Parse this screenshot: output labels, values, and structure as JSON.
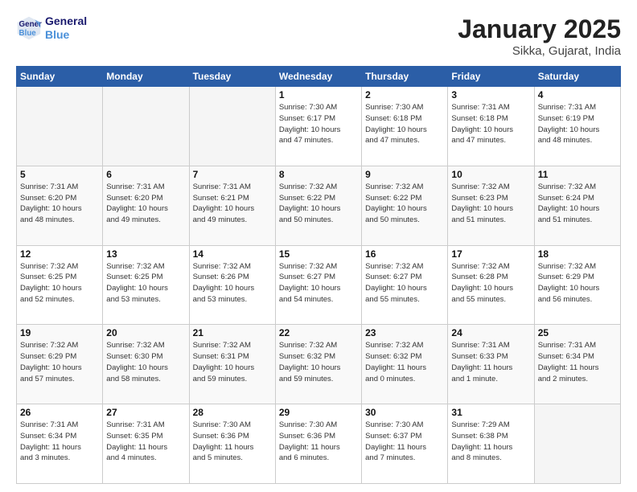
{
  "header": {
    "logo_line1": "General",
    "logo_line2": "Blue",
    "title": "January 2025",
    "subtitle": "Sikka, Gujarat, India"
  },
  "weekdays": [
    "Sunday",
    "Monday",
    "Tuesday",
    "Wednesday",
    "Thursday",
    "Friday",
    "Saturday"
  ],
  "weeks": [
    [
      {
        "day": "",
        "info": ""
      },
      {
        "day": "",
        "info": ""
      },
      {
        "day": "",
        "info": ""
      },
      {
        "day": "1",
        "info": "Sunrise: 7:30 AM\nSunset: 6:17 PM\nDaylight: 10 hours\nand 47 minutes."
      },
      {
        "day": "2",
        "info": "Sunrise: 7:30 AM\nSunset: 6:18 PM\nDaylight: 10 hours\nand 47 minutes."
      },
      {
        "day": "3",
        "info": "Sunrise: 7:31 AM\nSunset: 6:18 PM\nDaylight: 10 hours\nand 47 minutes."
      },
      {
        "day": "4",
        "info": "Sunrise: 7:31 AM\nSunset: 6:19 PM\nDaylight: 10 hours\nand 48 minutes."
      }
    ],
    [
      {
        "day": "5",
        "info": "Sunrise: 7:31 AM\nSunset: 6:20 PM\nDaylight: 10 hours\nand 48 minutes."
      },
      {
        "day": "6",
        "info": "Sunrise: 7:31 AM\nSunset: 6:20 PM\nDaylight: 10 hours\nand 49 minutes."
      },
      {
        "day": "7",
        "info": "Sunrise: 7:31 AM\nSunset: 6:21 PM\nDaylight: 10 hours\nand 49 minutes."
      },
      {
        "day": "8",
        "info": "Sunrise: 7:32 AM\nSunset: 6:22 PM\nDaylight: 10 hours\nand 50 minutes."
      },
      {
        "day": "9",
        "info": "Sunrise: 7:32 AM\nSunset: 6:22 PM\nDaylight: 10 hours\nand 50 minutes."
      },
      {
        "day": "10",
        "info": "Sunrise: 7:32 AM\nSunset: 6:23 PM\nDaylight: 10 hours\nand 51 minutes."
      },
      {
        "day": "11",
        "info": "Sunrise: 7:32 AM\nSunset: 6:24 PM\nDaylight: 10 hours\nand 51 minutes."
      }
    ],
    [
      {
        "day": "12",
        "info": "Sunrise: 7:32 AM\nSunset: 6:25 PM\nDaylight: 10 hours\nand 52 minutes."
      },
      {
        "day": "13",
        "info": "Sunrise: 7:32 AM\nSunset: 6:25 PM\nDaylight: 10 hours\nand 53 minutes."
      },
      {
        "day": "14",
        "info": "Sunrise: 7:32 AM\nSunset: 6:26 PM\nDaylight: 10 hours\nand 53 minutes."
      },
      {
        "day": "15",
        "info": "Sunrise: 7:32 AM\nSunset: 6:27 PM\nDaylight: 10 hours\nand 54 minutes."
      },
      {
        "day": "16",
        "info": "Sunrise: 7:32 AM\nSunset: 6:27 PM\nDaylight: 10 hours\nand 55 minutes."
      },
      {
        "day": "17",
        "info": "Sunrise: 7:32 AM\nSunset: 6:28 PM\nDaylight: 10 hours\nand 55 minutes."
      },
      {
        "day": "18",
        "info": "Sunrise: 7:32 AM\nSunset: 6:29 PM\nDaylight: 10 hours\nand 56 minutes."
      }
    ],
    [
      {
        "day": "19",
        "info": "Sunrise: 7:32 AM\nSunset: 6:29 PM\nDaylight: 10 hours\nand 57 minutes."
      },
      {
        "day": "20",
        "info": "Sunrise: 7:32 AM\nSunset: 6:30 PM\nDaylight: 10 hours\nand 58 minutes."
      },
      {
        "day": "21",
        "info": "Sunrise: 7:32 AM\nSunset: 6:31 PM\nDaylight: 10 hours\nand 59 minutes."
      },
      {
        "day": "22",
        "info": "Sunrise: 7:32 AM\nSunset: 6:32 PM\nDaylight: 10 hours\nand 59 minutes."
      },
      {
        "day": "23",
        "info": "Sunrise: 7:32 AM\nSunset: 6:32 PM\nDaylight: 11 hours\nand 0 minutes."
      },
      {
        "day": "24",
        "info": "Sunrise: 7:31 AM\nSunset: 6:33 PM\nDaylight: 11 hours\nand 1 minute."
      },
      {
        "day": "25",
        "info": "Sunrise: 7:31 AM\nSunset: 6:34 PM\nDaylight: 11 hours\nand 2 minutes."
      }
    ],
    [
      {
        "day": "26",
        "info": "Sunrise: 7:31 AM\nSunset: 6:34 PM\nDaylight: 11 hours\nand 3 minutes."
      },
      {
        "day": "27",
        "info": "Sunrise: 7:31 AM\nSunset: 6:35 PM\nDaylight: 11 hours\nand 4 minutes."
      },
      {
        "day": "28",
        "info": "Sunrise: 7:30 AM\nSunset: 6:36 PM\nDaylight: 11 hours\nand 5 minutes."
      },
      {
        "day": "29",
        "info": "Sunrise: 7:30 AM\nSunset: 6:36 PM\nDaylight: 11 hours\nand 6 minutes."
      },
      {
        "day": "30",
        "info": "Sunrise: 7:30 AM\nSunset: 6:37 PM\nDaylight: 11 hours\nand 7 minutes."
      },
      {
        "day": "31",
        "info": "Sunrise: 7:29 AM\nSunset: 6:38 PM\nDaylight: 11 hours\nand 8 minutes."
      },
      {
        "day": "",
        "info": ""
      }
    ]
  ]
}
